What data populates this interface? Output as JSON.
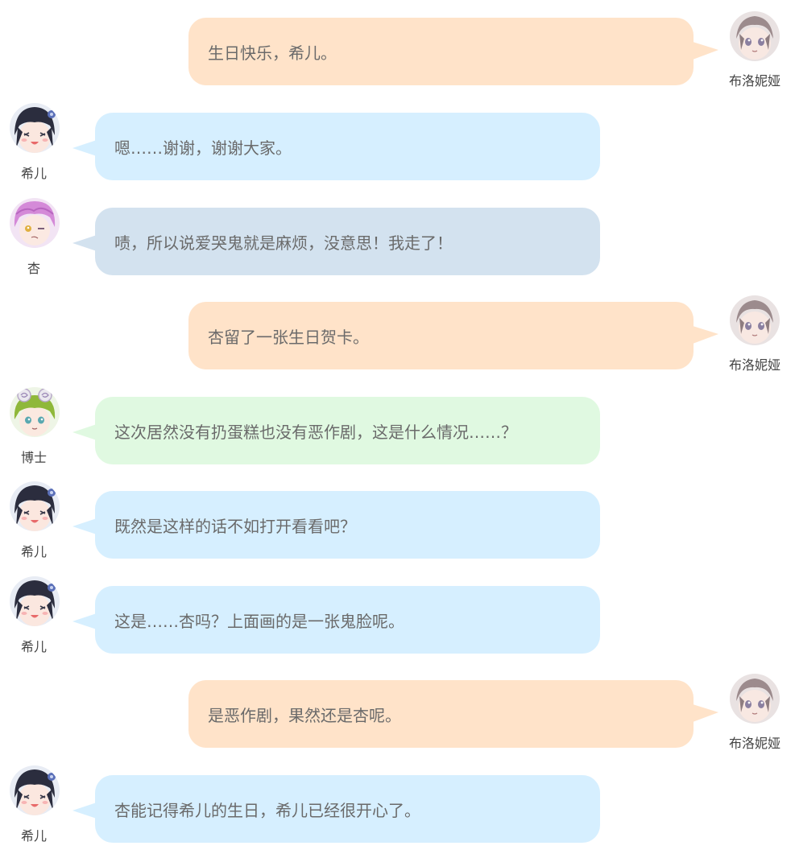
{
  "colors": {
    "blue": "#d6efff",
    "slate": "#d3e2ef",
    "peach": "#ffe3c9",
    "green": "#e0f9e1"
  },
  "messages": [
    {
      "side": "right",
      "name": "布洛妮娅",
      "avatar": "bronya-avatar",
      "text": "生日快乐，希儿。",
      "color": "#ffe3c9"
    },
    {
      "side": "left",
      "name": "希儿",
      "avatar": "seele-avatar",
      "text": "嗯……谢谢，谢谢大家。",
      "color": "#d6efff"
    },
    {
      "side": "left",
      "name": "杏",
      "avatar": "xing-avatar",
      "text": "啧，所以说爱哭鬼就是麻烦，没意思！我走了！",
      "color": "#d3e2ef"
    },
    {
      "side": "right",
      "name": "布洛妮娅",
      "avatar": "bronya-avatar",
      "text": "杏留了一张生日贺卡。",
      "color": "#ffe3c9"
    },
    {
      "side": "left",
      "name": "博士",
      "avatar": "doctor-avatar",
      "text": "这次居然没有扔蛋糕也没有恶作剧，这是什么情况……？",
      "color": "#e0f9e1"
    },
    {
      "side": "left",
      "name": "希儿",
      "avatar": "seele-avatar",
      "text": "既然是这样的话不如打开看看吧？",
      "color": "#d6efff"
    },
    {
      "side": "left",
      "name": "希儿",
      "avatar": "seele-avatar",
      "text": "这是……杏吗？上面画的是一张鬼脸呢。",
      "color": "#d6efff"
    },
    {
      "side": "right",
      "name": "布洛妮娅",
      "avatar": "bronya-avatar",
      "text": "是恶作剧，果然还是杏呢。",
      "color": "#ffe3c9"
    },
    {
      "side": "left",
      "name": "希儿",
      "avatar": "seele-avatar",
      "text": "杏能记得希儿的生日，希儿已经很开心了。",
      "color": "#d6efff"
    }
  ]
}
